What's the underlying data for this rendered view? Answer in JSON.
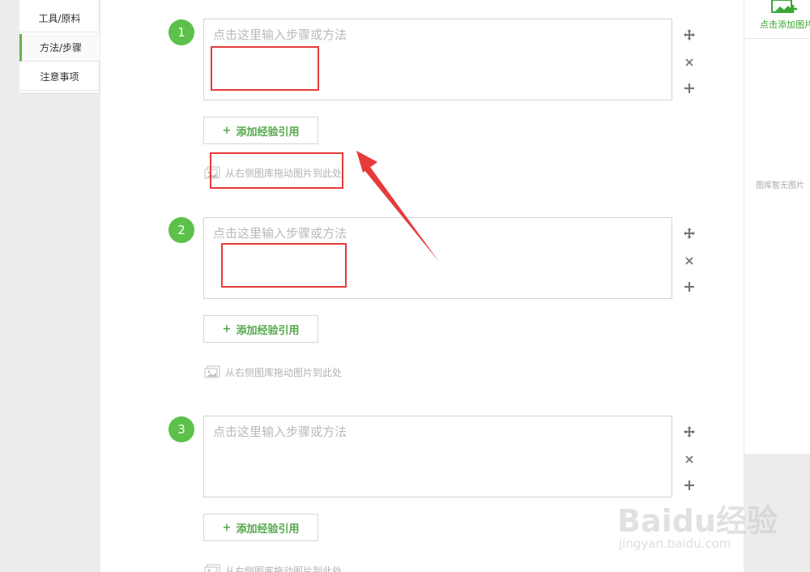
{
  "sidebar": {
    "items": [
      {
        "label": "工具/原料"
      },
      {
        "label": "方法/步骤"
      },
      {
        "label": "注意事项"
      }
    ]
  },
  "steps": [
    {
      "number": "1",
      "placeholder": "点击这里输入步骤或方法",
      "ref_label": "添加经验引用",
      "drag_hint": "从右侧图库拖动图片到此处"
    },
    {
      "number": "2",
      "placeholder": "点击这里输入步骤或方法",
      "ref_label": "添加经验引用",
      "drag_hint": "从右侧图库拖动图片到此处"
    },
    {
      "number": "3",
      "placeholder": "点击这里输入步骤或方法",
      "ref_label": "添加经验引用",
      "drag_hint": "从右侧图库拖动图片到此处"
    }
  ],
  "controls": {
    "move": "move-icon",
    "delete": "close-icon",
    "add": "plus-icon",
    "plus_symbol": "+"
  },
  "right_panel": {
    "add_image_label": "点击添加图片",
    "empty_label": "图库暂无图片"
  },
  "watermark": {
    "logo": "Baidu经验",
    "url": "jingyan.baidu.com"
  },
  "colors": {
    "accent": "#5cc14a",
    "annotation": "#e63b3b"
  }
}
